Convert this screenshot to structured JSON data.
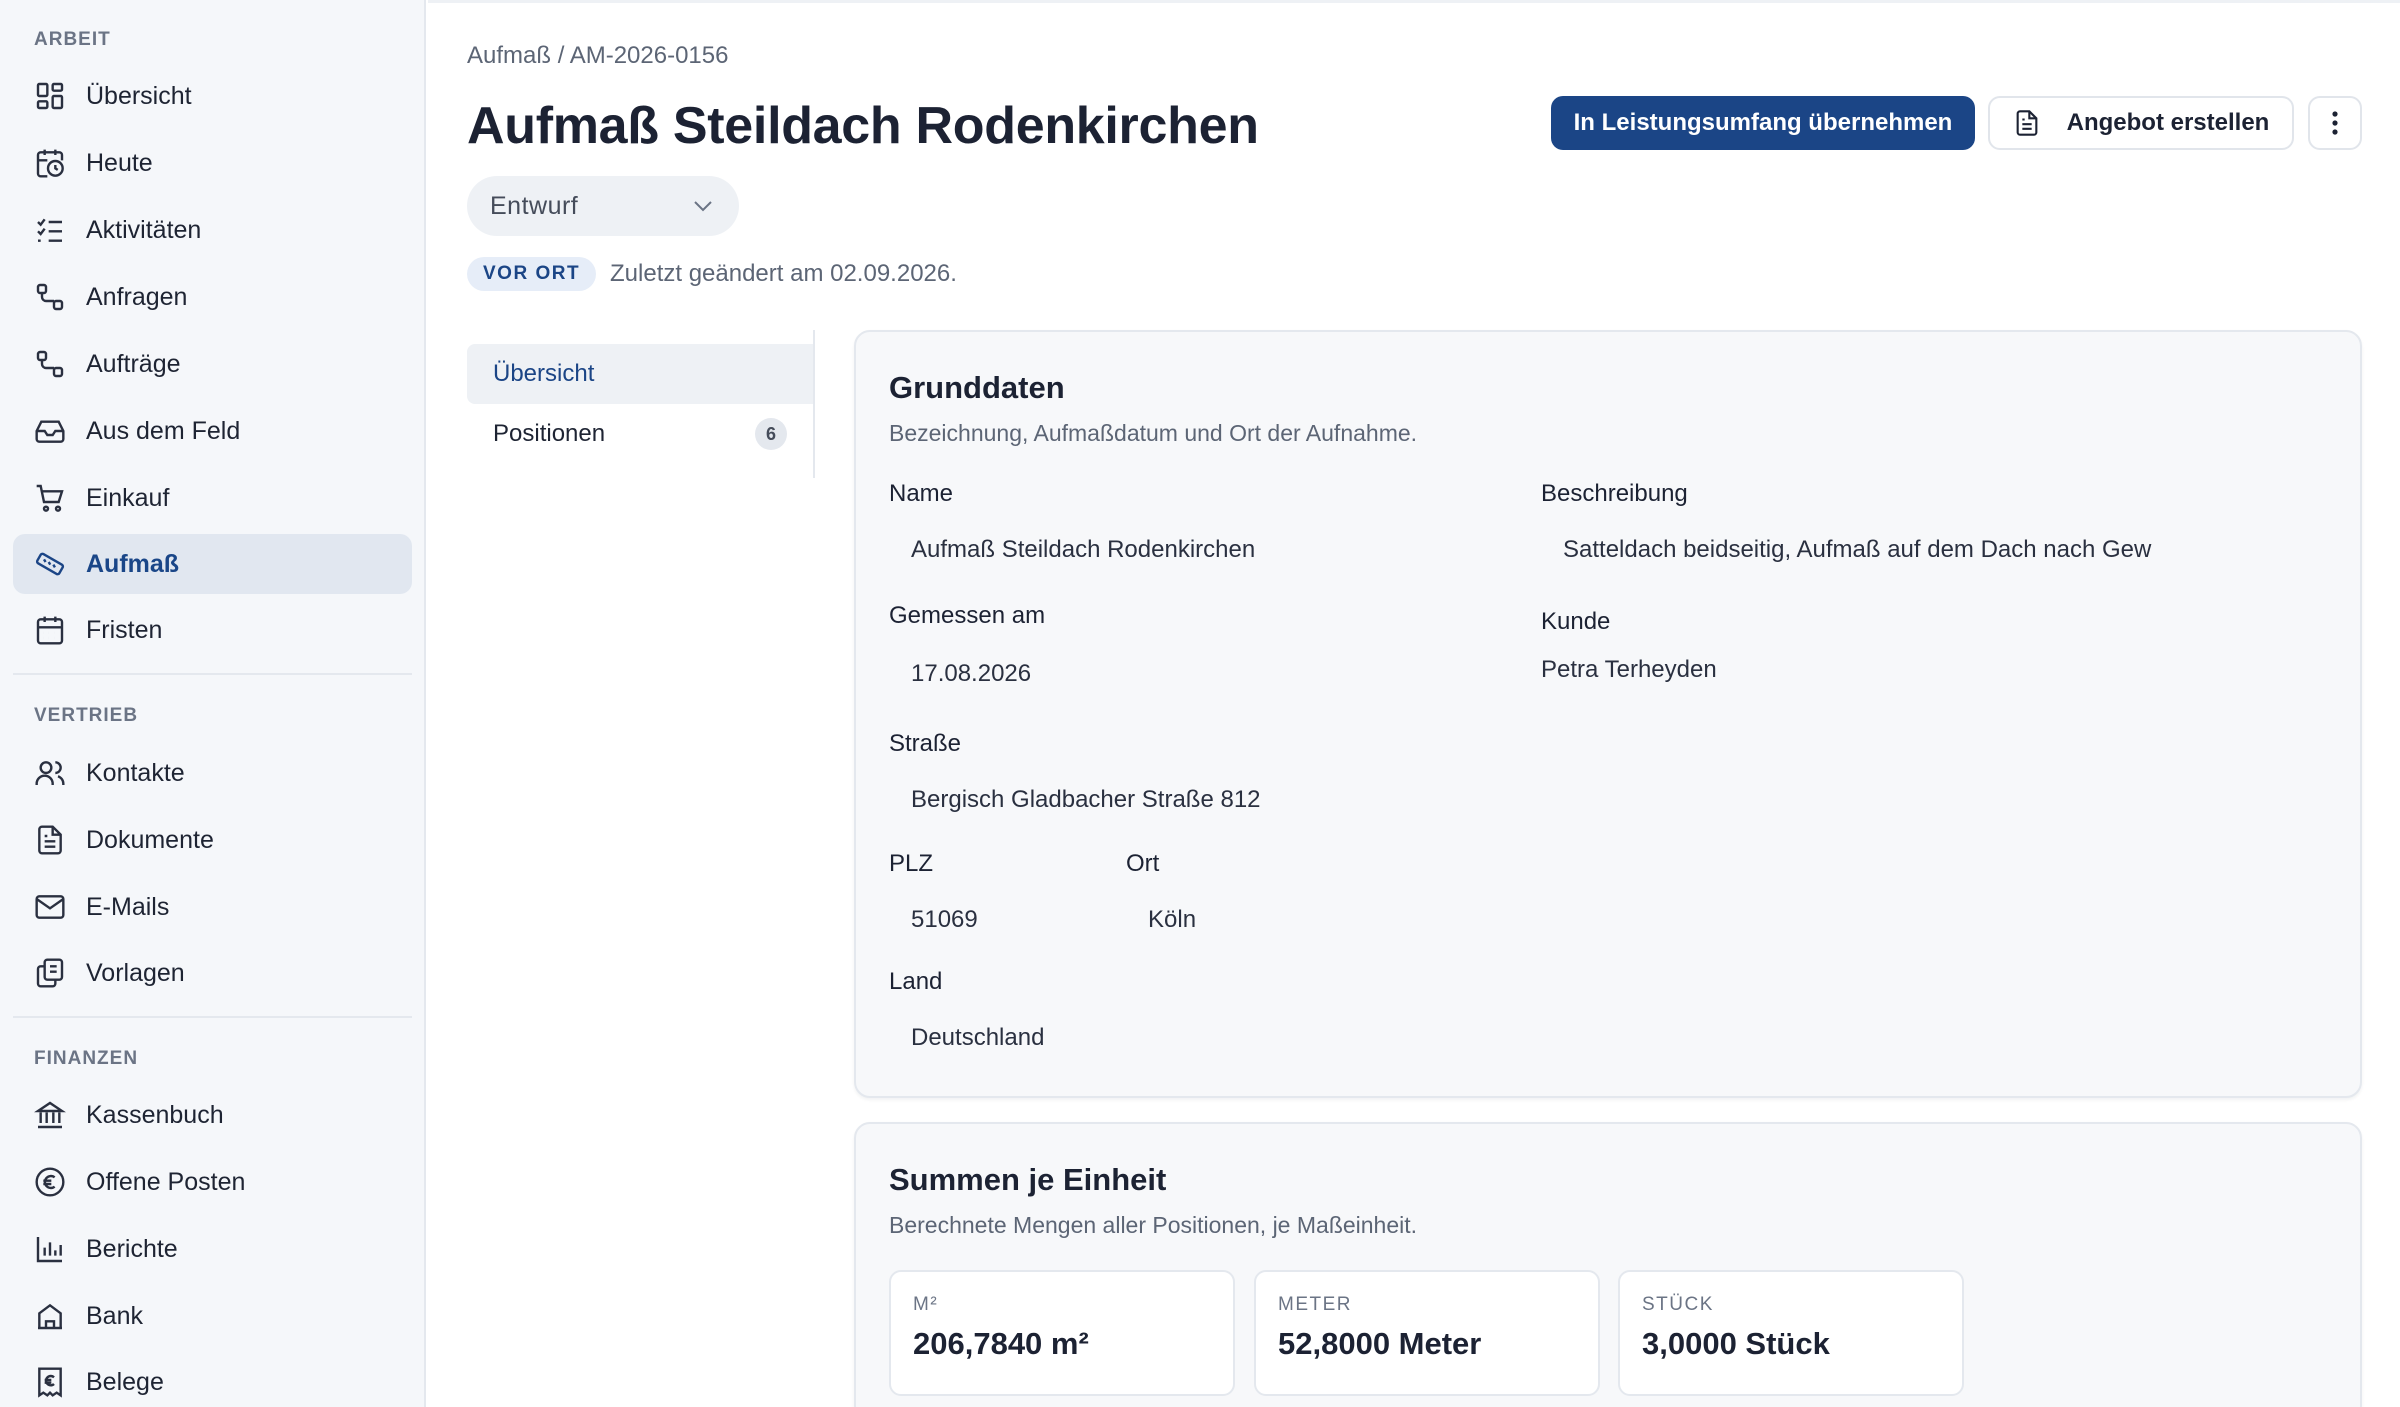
{
  "sidebar": {
    "sections": [
      {
        "label": "ARBEIT",
        "items": [
          {
            "label": "Übersicht",
            "icon": "dashboard-icon"
          },
          {
            "label": "Heute",
            "icon": "calendar-clock-icon"
          },
          {
            "label": "Aktivitäten",
            "icon": "checklist-icon"
          },
          {
            "label": "Anfragen",
            "icon": "route-icon"
          },
          {
            "label": "Aufträge",
            "icon": "route-icon"
          },
          {
            "label": "Aus dem Feld",
            "icon": "inbox-icon"
          },
          {
            "label": "Einkauf",
            "icon": "cart-icon"
          },
          {
            "label": "Aufmaß",
            "icon": "ruler-icon",
            "active": true
          },
          {
            "label": "Fristen",
            "icon": "calendar-icon"
          }
        ]
      },
      {
        "label": "VERTRIEB",
        "items": [
          {
            "label": "Kontakte",
            "icon": "users-icon"
          },
          {
            "label": "Dokumente",
            "icon": "document-icon"
          },
          {
            "label": "E-Mails",
            "icon": "mail-icon"
          },
          {
            "label": "Vorlagen",
            "icon": "copy-icon"
          }
        ]
      },
      {
        "label": "FINANZEN",
        "items": [
          {
            "label": "Kassenbuch",
            "icon": "bank-icon"
          },
          {
            "label": "Offene Posten",
            "icon": "euro-circle-icon"
          },
          {
            "label": "Berichte",
            "icon": "bar-chart-icon"
          },
          {
            "label": "Bank",
            "icon": "bank-building-icon"
          },
          {
            "label": "Belege",
            "icon": "receipt-euro-icon"
          }
        ]
      }
    ]
  },
  "header": {
    "breadcrumb": "Aufmaß / AM-2026-0156",
    "title": "Aufmaß Steildach Rodenkirchen",
    "primary_button": "In Leistungsumfang übernehmen",
    "secondary_button": "Angebot erstellen",
    "status": "Entwurf",
    "badge": "VOR ORT",
    "changed": "Zuletzt geändert am 02.09.2026."
  },
  "tabs": [
    {
      "label": "Übersicht",
      "active": true
    },
    {
      "label": "Positionen",
      "count": "6"
    }
  ],
  "grunddaten": {
    "title": "Grunddaten",
    "subtitle": "Bezeichnung, Aufmaßdatum und Ort der Aufnahme.",
    "name_label": "Name",
    "name_value": "Aufmaß Steildach Rodenkirchen",
    "beschreibung_label": "Beschreibung",
    "beschreibung_value": "Satteldach beidseitig, Aufmaß auf dem Dach nach Gewerk",
    "gemessen_label": "Gemessen am",
    "gemessen_value": "17.08.2026",
    "kunde_label": "Kunde",
    "kunde_value": "Petra Terheyden",
    "strasse_label": "Straße",
    "strasse_value": "Bergisch Gladbacher Straße 812",
    "plz_label": "PLZ",
    "plz_value": "51069",
    "ort_label": "Ort",
    "ort_value": "Köln",
    "land_label": "Land",
    "land_value": "Deutschland"
  },
  "summen": {
    "title": "Summen je Einheit",
    "subtitle": "Berechnete Mengen aller Positionen, je Maßeinheit.",
    "stats": [
      {
        "label": "M²",
        "value": "206,7840 m²"
      },
      {
        "label": "METER",
        "value": "52,8000 Meter"
      },
      {
        "label": "STÜCK",
        "value": "3,0000 Stück"
      }
    ]
  },
  "colors": {
    "accent": "#1b4586",
    "active_bg": "#e1e7f0",
    "sidebar_bg": "#f5f7fa"
  }
}
